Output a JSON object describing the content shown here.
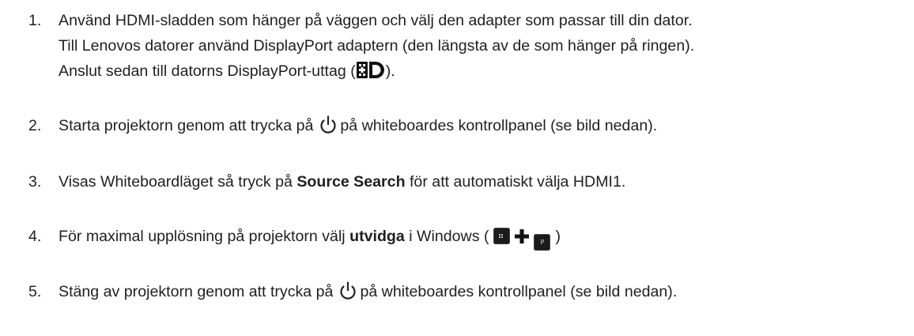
{
  "steps": [
    {
      "number": "1.",
      "lines": [
        "Använd HDMI-sladden som hänger på väggen och välj den adapter som passar till din dator.",
        "Till Lenovos datorer använd DisplayPort adaptern (den längsta av de som hänger på ringen).",
        "Anslut sedan till datorns DisplayPort-uttag ("
      ],
      "line3_end": ").",
      "icon": "displayport-logo"
    },
    {
      "number": "2.",
      "before": "Starta projektorn genom att trycka på",
      "after": "på whiteboardes kontrollpanel (se bild nedan).",
      "icon": "power-icon"
    },
    {
      "number": "3.",
      "before": "Visas Whiteboardläget så tryck på ",
      "bold": "Source Search",
      "after": " för att automatiskt välja HDMI1."
    },
    {
      "number": "4.",
      "before": "För maximal upplösning på projektorn välj ",
      "bold": "utvidga",
      "after": " i Windows (",
      "end": ")",
      "key1_icon": "windows-key-icon",
      "key2_label": "P"
    },
    {
      "number": "5.",
      "before": "Stäng av projektorn genom att trycka på",
      "after": "på whiteboardes kontrollpanel (se bild nedan).",
      "icon": "power-icon"
    }
  ],
  "colors": {
    "text": "#1f1f1f",
    "key": "#1b1b1b"
  }
}
